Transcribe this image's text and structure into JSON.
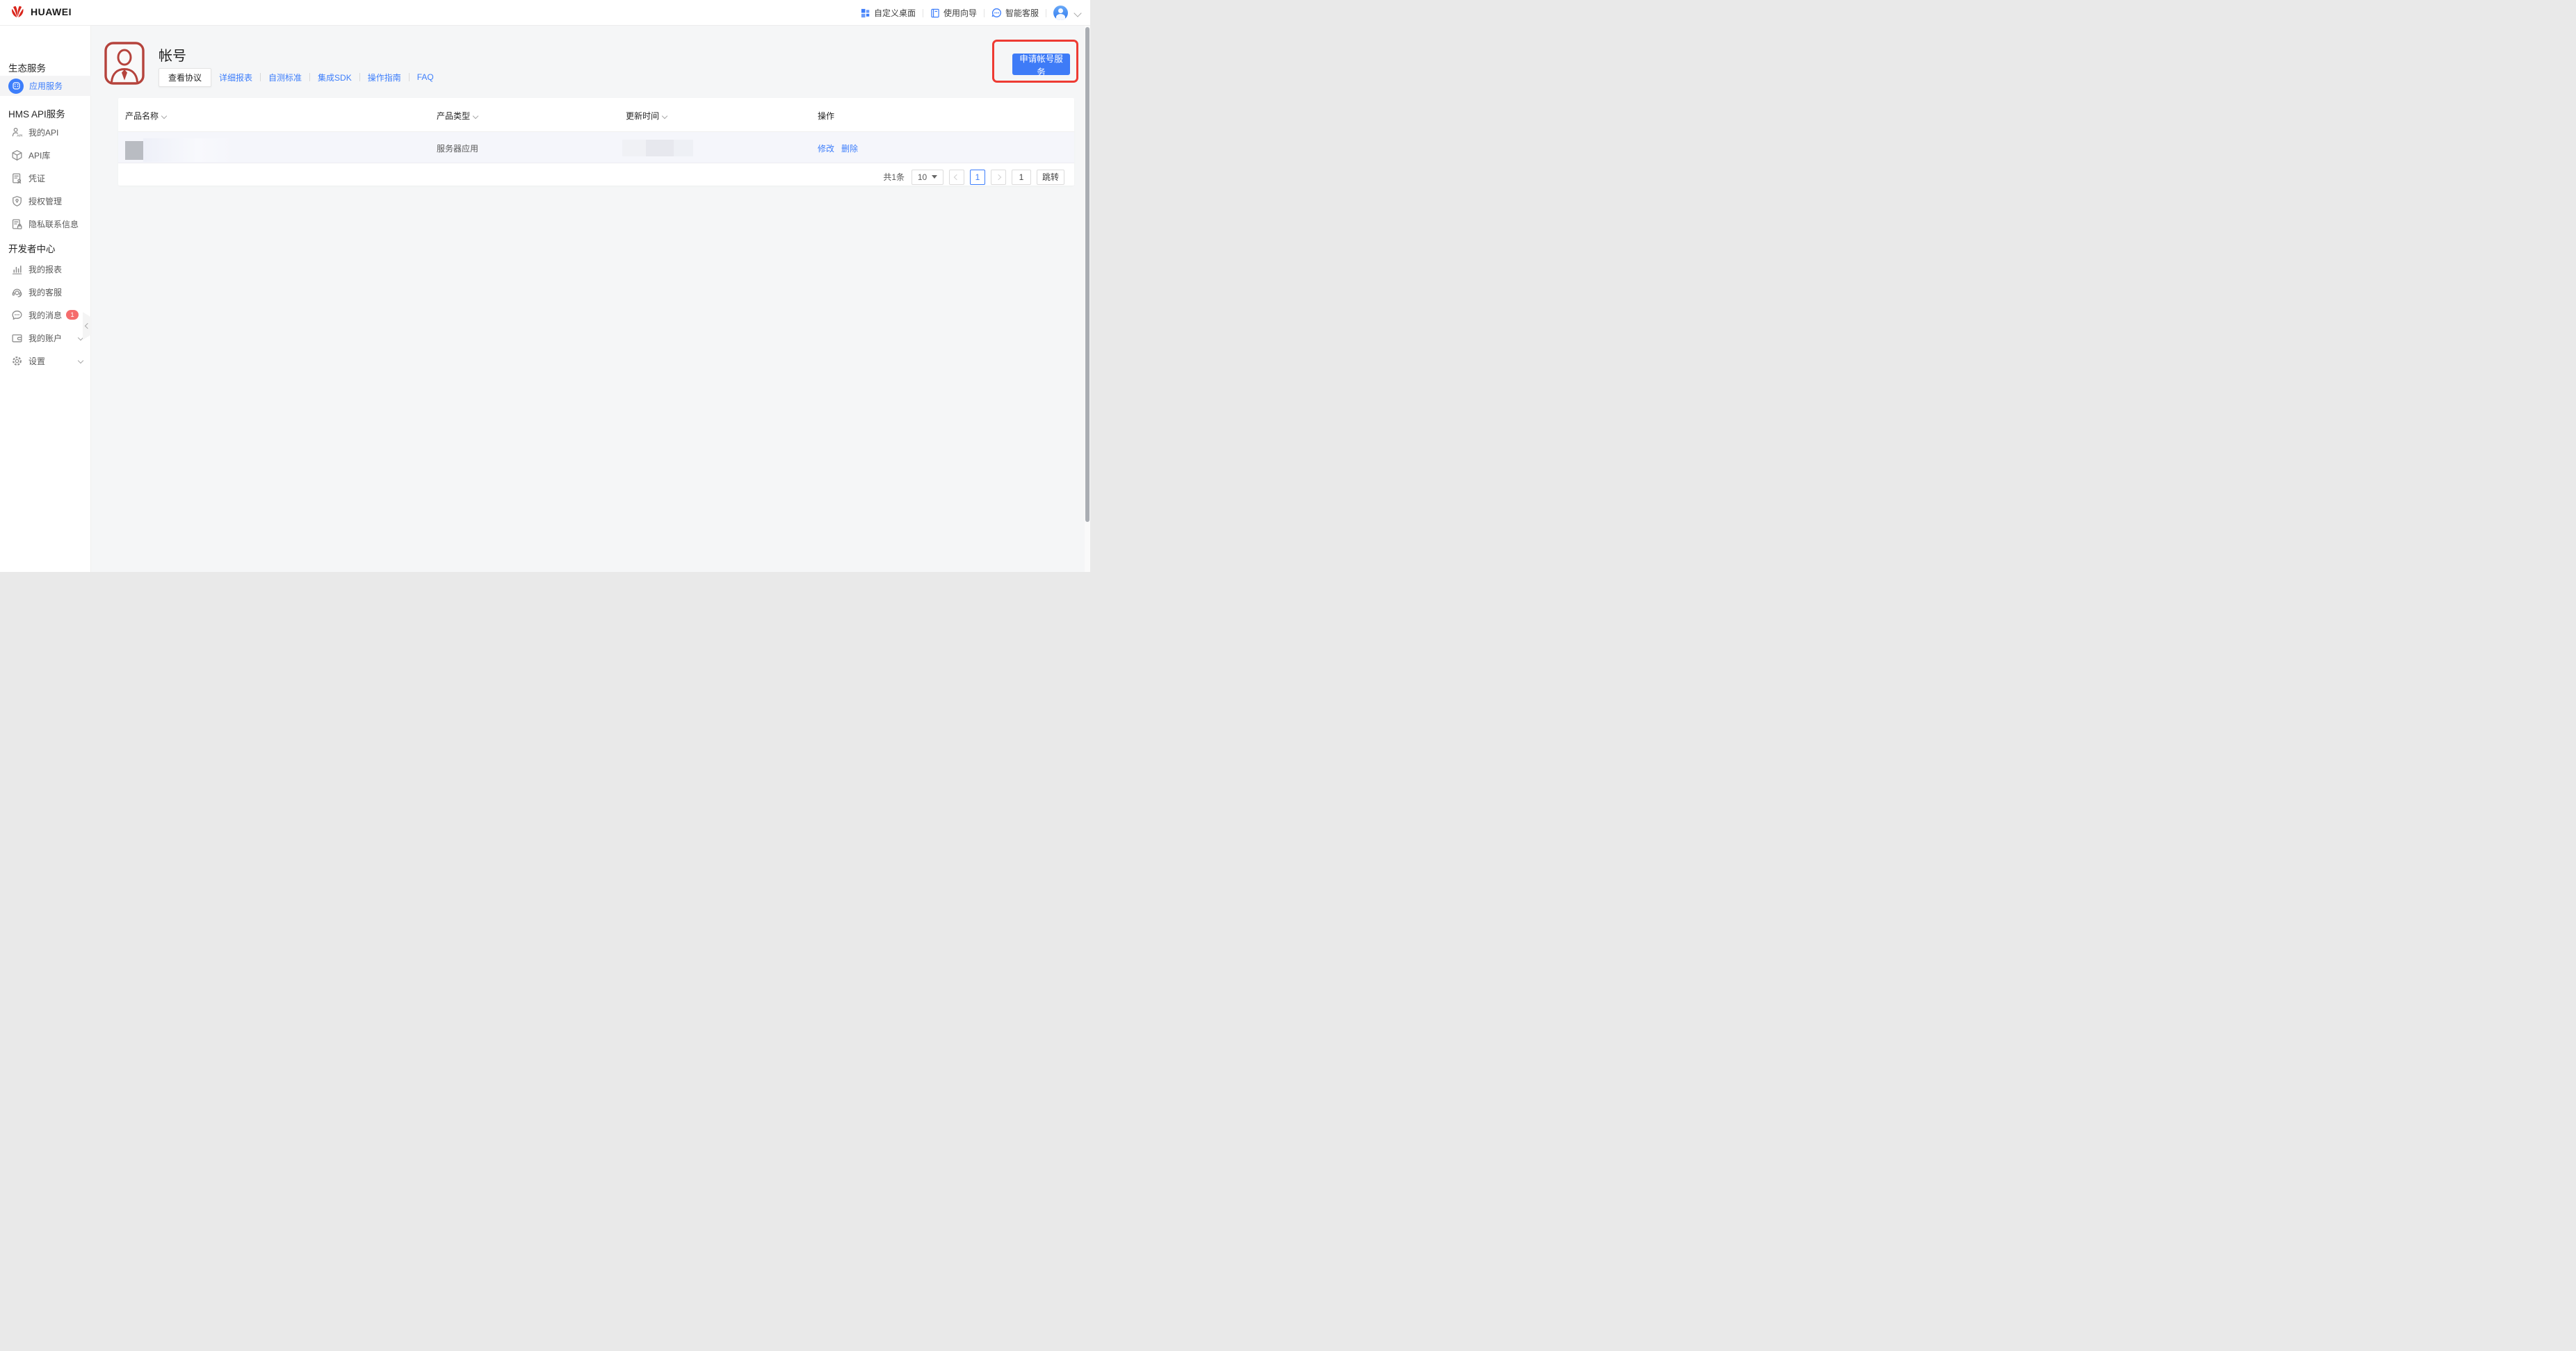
{
  "topbar": {
    "brand": "HUAWEI",
    "links": [
      {
        "label": "自定义桌面"
      },
      {
        "label": "使用向导"
      },
      {
        "label": "智能客服"
      }
    ]
  },
  "sidebar": {
    "sections": [
      {
        "header": "生态服务",
        "items": [
          {
            "label": "应用服务"
          }
        ]
      },
      {
        "header": "HMS API服务",
        "items": [
          {
            "label": "我的API"
          },
          {
            "label": "API库"
          },
          {
            "label": "凭证"
          },
          {
            "label": "授权管理"
          },
          {
            "label": "隐私联系信息"
          }
        ]
      },
      {
        "header": "开发者中心",
        "items": [
          {
            "label": "我的报表"
          },
          {
            "label": "我的客服"
          },
          {
            "label": "我的消息",
            "badge": "1"
          },
          {
            "label": "我的账户"
          },
          {
            "label": "设置"
          }
        ]
      }
    ]
  },
  "page": {
    "title": "帐号",
    "tabs": [
      {
        "label": "查看协议"
      },
      {
        "label": "详细报表"
      },
      {
        "label": "自测标准"
      },
      {
        "label": "集成SDK"
      },
      {
        "label": "操作指南"
      },
      {
        "label": "FAQ"
      }
    ],
    "apply_button": "申请帐号服务"
  },
  "table": {
    "columns": [
      {
        "label": "产品名称"
      },
      {
        "label": "产品类型"
      },
      {
        "label": "更新时间"
      },
      {
        "label": "操作"
      }
    ],
    "rows": [
      {
        "product_type": "服务器应用",
        "action_edit": "修改",
        "action_delete": "删除"
      }
    ]
  },
  "pagination": {
    "total": "共1条",
    "page_size": "10",
    "current_page": "1",
    "jump_value": "1",
    "jump_button": "跳转"
  },
  "colors": {
    "accent": "#3D7EFB",
    "annotation_red": "#EE3B33",
    "brand_red": "#D9261C",
    "account_icon_red": "#B5433C",
    "badge_red": "#F56C6C",
    "page_bg": "#F5F6F7",
    "row_highlight": "#F5F6FB"
  }
}
